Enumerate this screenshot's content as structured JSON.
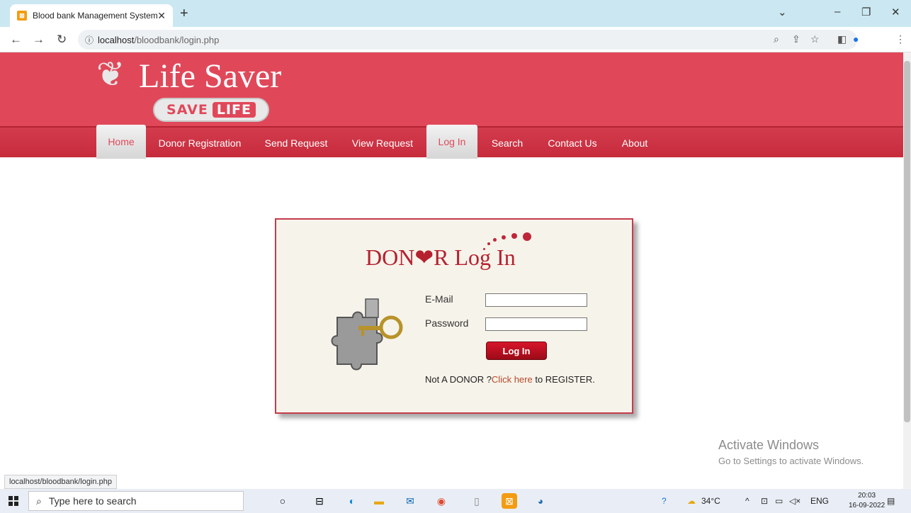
{
  "browser": {
    "tab_title": "Blood bank Management System",
    "url_host": "localhost",
    "url_path": "/bloodbank/login.php",
    "status_url": "localhost/bloodbank/login.php"
  },
  "site": {
    "logo_text": "Life Saver",
    "logo_save": "SAVE",
    "logo_life": "LIFE",
    "menu": [
      {
        "label": "Home"
      },
      {
        "label": "Donor Registration"
      },
      {
        "label": "Send Request"
      },
      {
        "label": "View Request"
      },
      {
        "label": "Log In"
      },
      {
        "label": "Search"
      },
      {
        "label": "Contact Us"
      },
      {
        "label": "About"
      }
    ]
  },
  "login": {
    "title": "DON❤R Log In",
    "email_label": "E-Mail",
    "password_label": "Password",
    "button_label": "Log In",
    "register_prefix": "Not A DONOR ?",
    "register_link": "Click here",
    "register_suffix": " to REGISTER."
  },
  "watermark": {
    "line1": "Activate Windows",
    "line2": "Go to Settings to activate Windows."
  },
  "taskbar": {
    "search_placeholder": "Type here to search",
    "temperature": "34°C",
    "language": "ENG",
    "time": "20:03",
    "date": "16-09-2022"
  },
  "colors": {
    "header": "#e0485a",
    "accent": "#b5212f"
  }
}
